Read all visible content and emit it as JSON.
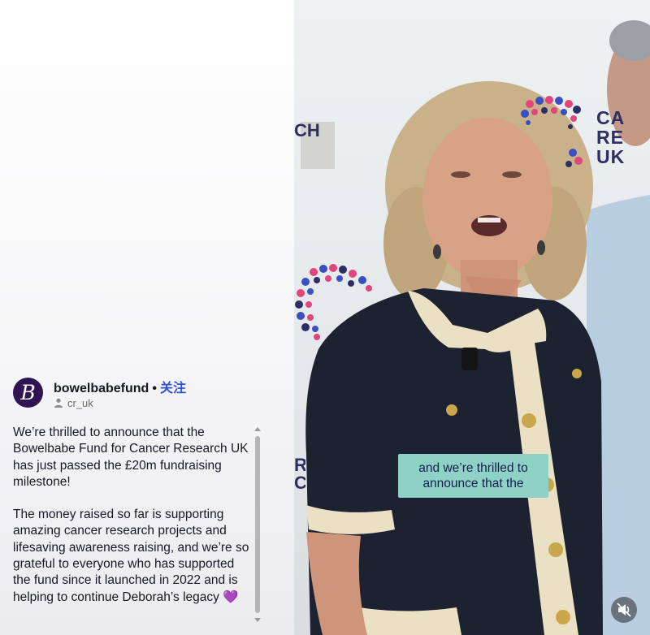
{
  "profile": {
    "username": "bowelbabefund",
    "separator": "•",
    "follow_label": "关注",
    "avatar_letter": "B",
    "sub_name": "cr_uk"
  },
  "caption": {
    "paragraph1": "We’re thrilled to announce that the Bowelbabe Fund for Cancer Research UK has just passed the £20m fundraising milestone!",
    "paragraph2": "The money raised so far is supporting amazing cancer research projects and lifesaving awareness raising, and we’re so grateful to everyone who has supported the fund since it launched in 2022 and is helping to continue Deborah’s legacy",
    "emoji": "💜"
  },
  "video": {
    "backdrop_logo_lines": [
      "CA",
      "RE",
      "UK"
    ],
    "edge_text_top": "CH",
    "edge_text_bottom": [
      "R",
      "C"
    ],
    "subtitle_line1": "and we’re thrilled to",
    "subtitle_line2": "announce that the",
    "mute_icon": "speaker-muted-icon"
  },
  "colors": {
    "avatar_bg": "#2e1452",
    "follow": "#2f52d8",
    "subtitle_bg": "#8ed1c6",
    "brand_navy": "#2d2f64",
    "brand_pink": "#e0457b",
    "brand_blue": "#3a4fc0"
  }
}
